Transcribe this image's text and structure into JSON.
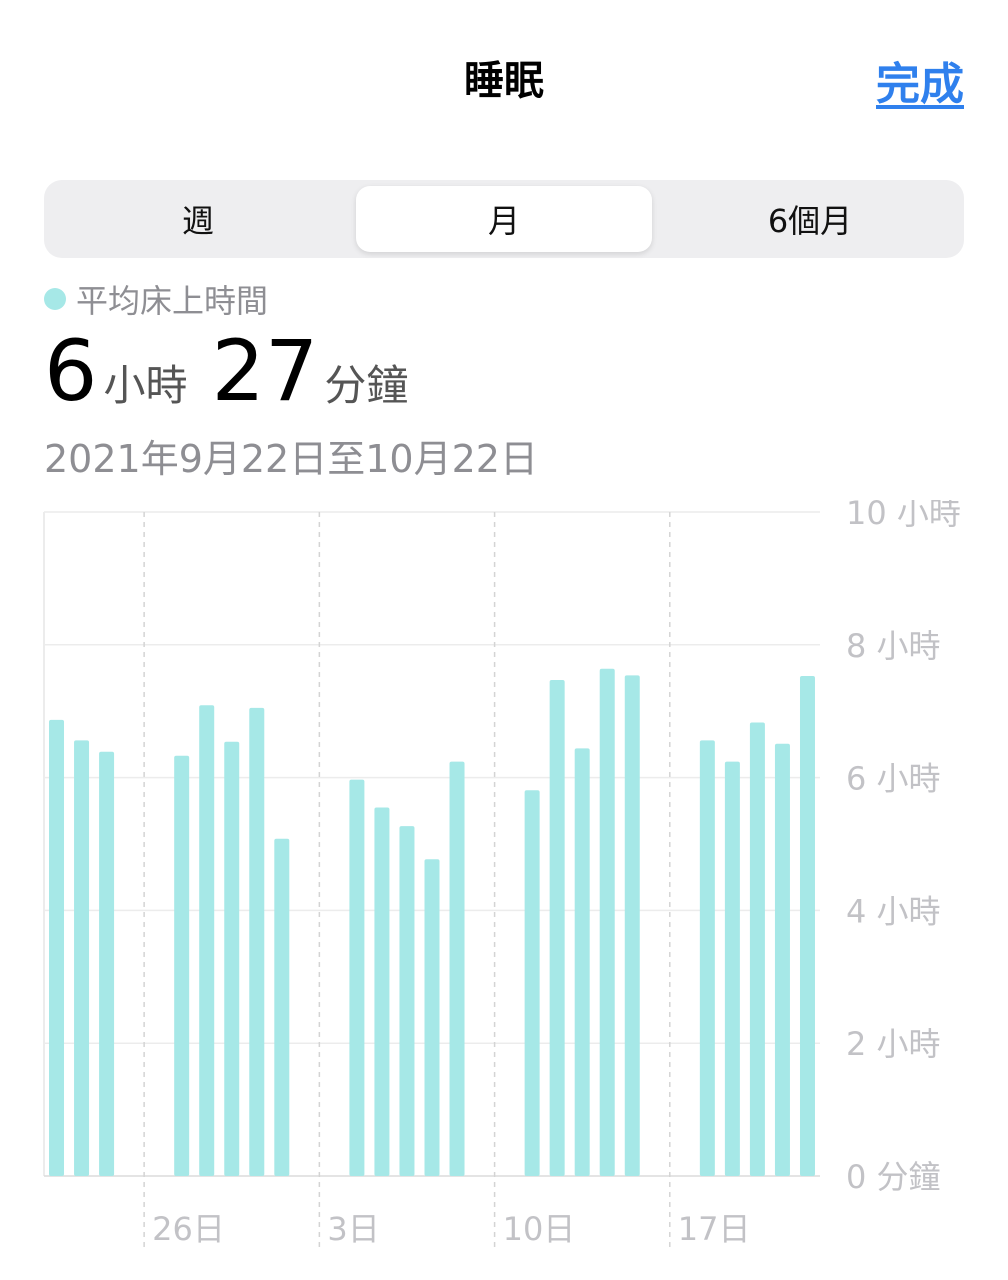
{
  "header": {
    "title": "睡眠",
    "done_label": "完成"
  },
  "tabs": [
    {
      "label": "週",
      "selected": false
    },
    {
      "label": "月",
      "selected": true
    },
    {
      "label": "6個月",
      "selected": false
    }
  ],
  "legend": {
    "label": "平均床上時間",
    "color": "#a6e8e7"
  },
  "summary": {
    "hours": "6",
    "hours_unit": "小時",
    "minutes": "27",
    "minutes_unit": "分鐘"
  },
  "date_range": "2021年9月22日至10月22日",
  "chart_data": {
    "type": "bar",
    "title": "",
    "xlabel": "",
    "ylabel": "",
    "categories": [
      "9/22",
      "9/23",
      "9/24",
      "9/25",
      "9/26",
      "9/27",
      "9/28",
      "9/29",
      "9/30",
      "10/1",
      "10/2",
      "10/3",
      "10/4",
      "10/5",
      "10/6",
      "10/7",
      "10/8",
      "10/9",
      "10/10",
      "10/11",
      "10/12",
      "10/13",
      "10/14",
      "10/15",
      "10/16",
      "10/17",
      "10/18",
      "10/19",
      "10/20",
      "10/21",
      "10/22"
    ],
    "values": [
      6.87,
      6.56,
      6.39,
      null,
      null,
      6.33,
      7.09,
      6.54,
      7.05,
      5.08,
      null,
      null,
      5.97,
      5.55,
      5.27,
      4.77,
      6.24,
      null,
      null,
      5.81,
      7.47,
      6.44,
      7.64,
      7.54,
      null,
      null,
      6.56,
      6.24,
      6.83,
      6.51,
      7.53
    ],
    "x_tick_labels": [
      {
        "index": 4,
        "label": "26日"
      },
      {
        "index": 11,
        "label": "3日"
      },
      {
        "index": 18,
        "label": "10日"
      },
      {
        "index": 25,
        "label": "17日"
      }
    ],
    "y_ticks": [
      {
        "value": 0,
        "label": "0 分鐘"
      },
      {
        "value": 2,
        "label": "2 小時"
      },
      {
        "value": 4,
        "label": "4 小時"
      },
      {
        "value": 6,
        "label": "6 小時"
      },
      {
        "value": 8,
        "label": "8 小時"
      },
      {
        "value": 10,
        "label": "10 小時"
      }
    ],
    "ylim": [
      0,
      10
    ],
    "bar_color": "#a6e8e7",
    "grid": true
  }
}
